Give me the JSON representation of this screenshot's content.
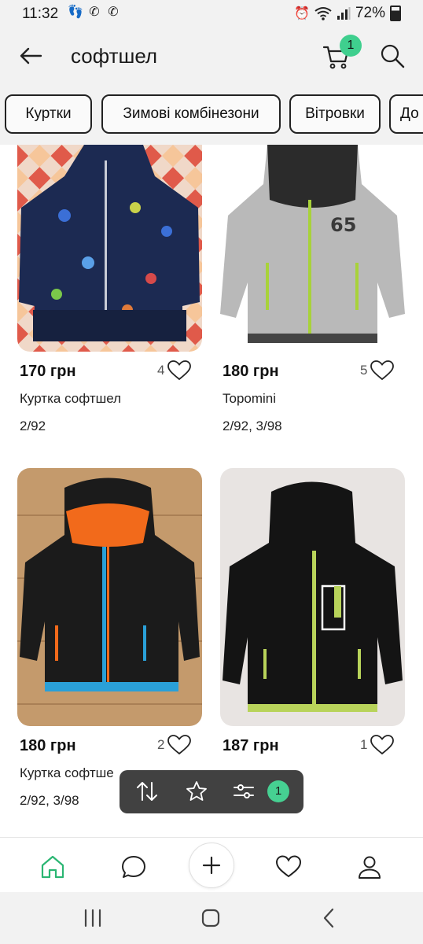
{
  "status_bar": {
    "time": "11:32",
    "battery": "72%"
  },
  "header": {
    "title": "софтшел",
    "cart_count": "1"
  },
  "chips": [
    {
      "label": "Куртки"
    },
    {
      "label": "Зимові комбінезони"
    },
    {
      "label": "Вітровки"
    },
    {
      "label": "До"
    }
  ],
  "listings": [
    {
      "price": "170 грн",
      "likes": "4",
      "name": "Куртка софтшел",
      "sizes": "2/92"
    },
    {
      "price": "180 грн",
      "likes": "5",
      "name": "Topomini",
      "sizes": "2/92, 3/98"
    },
    {
      "price": "180 грн",
      "likes": "2",
      "name": "Куртка софтше",
      "sizes": "2/92, 3/98"
    },
    {
      "price": "187 грн",
      "likes": "1",
      "name": "",
      "sizes": ""
    }
  ],
  "floating_toolbar": {
    "filter_count": "1"
  },
  "colors": {
    "accent": "#3fcf8e",
    "header_bg": "#f2f2f2",
    "toolbar_bg": "#3a3a3a"
  },
  "icons": {
    "back": "arrow-left-icon",
    "cart": "cart-icon",
    "search": "search-icon",
    "sort": "sort-arrows-icon",
    "star": "star-icon",
    "filter": "sliders-icon",
    "home": "home-icon",
    "chat": "chat-icon",
    "add": "plus-icon",
    "favorites": "heart-icon",
    "profile": "person-icon"
  }
}
